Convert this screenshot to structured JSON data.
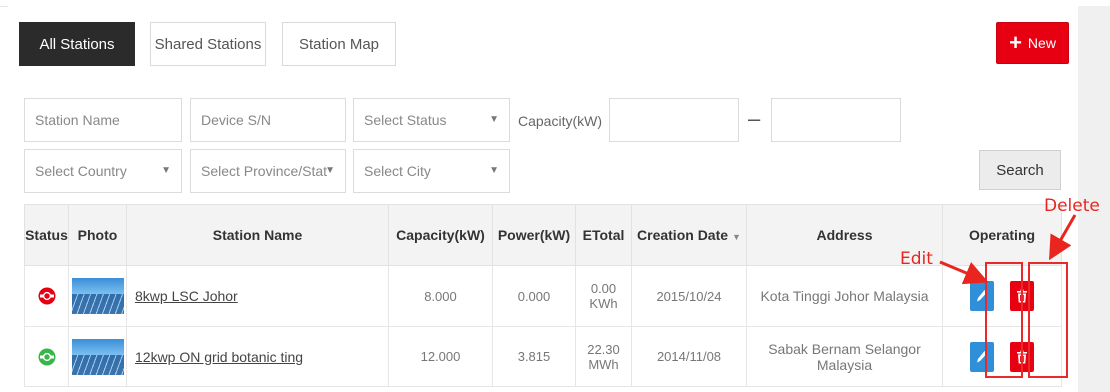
{
  "tabs": [
    {
      "label": "All Stations",
      "active": true
    },
    {
      "label": "Shared Stations",
      "active": false
    },
    {
      "label": "Station Map",
      "active": false
    }
  ],
  "new_button": {
    "icon": "plus-icon",
    "label": "New",
    "color": "#e60012"
  },
  "filters": {
    "station_name_placeholder": "Station Name",
    "device_sn_placeholder": "Device S/N",
    "status_placeholder": "Select Status",
    "capacity_label": "Capacity(kW)",
    "capacity_separator": "–",
    "country_placeholder": "Select Country",
    "province_placeholder": "Select Province/Stat",
    "city_placeholder": "Select City",
    "search_label": "Search"
  },
  "table": {
    "headers": [
      "Status",
      "Photo",
      "Station Name",
      "Capacity(kW)",
      "Power(kW)",
      "ETotal",
      "Creation Date",
      "Address",
      "Operating"
    ],
    "sorted_column": "Creation Date",
    "rows": [
      {
        "status": "offline",
        "status_color": "#e60012",
        "name": "8kwp LSC Johor",
        "capacity": "8.000",
        "power": "0.000",
        "etotal": "0.00 KWh",
        "created": "2015/10/24",
        "address": "Kota Tinggi Johor Malaysia"
      },
      {
        "status": "online",
        "status_color": "#3ab54a",
        "name": "12kwp ON grid botanic ting",
        "capacity": "12.000",
        "power": "3.815",
        "etotal": "22.30 MWh",
        "created": "2014/11/08",
        "address": "Sabak Bernam Selangor Malaysia"
      }
    ]
  },
  "annotations": {
    "edit": "Edit",
    "delete": "Delete",
    "color": "#e8261f"
  },
  "colors": {
    "edit_button": "#2f8fd8",
    "delete_button": "#e60012",
    "active_tab": "#2b2b2b"
  }
}
